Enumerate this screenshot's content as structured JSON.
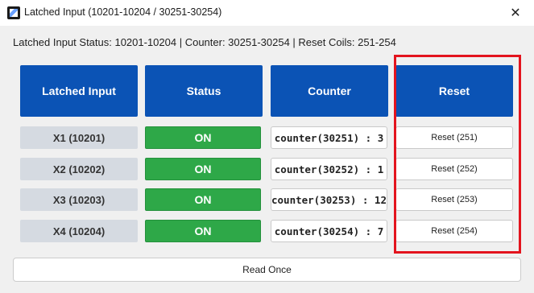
{
  "window": {
    "title": "Latched Input (10201-10204 / 30251-30254)",
    "app_icon": "app-icon",
    "close_symbol": "✕"
  },
  "status_line": "Latched Input Status: 10201-10204 | Counter: 30251-30254 | Reset Coils: 251-254",
  "headers": {
    "latched_input": "Latched Input",
    "status": "Status",
    "counter": "Counter",
    "reset": "Reset"
  },
  "rows": [
    {
      "label": "X1 (10201)",
      "status": "ON",
      "counter": "counter(30251) : 3",
      "reset": "Reset (251)"
    },
    {
      "label": "X2 (10202)",
      "status": "ON",
      "counter": "counter(30252) : 1",
      "reset": "Reset (252)"
    },
    {
      "label": "X3 (10203)",
      "status": "ON",
      "counter": "counter(30253) : 12",
      "reset": "Reset (253)"
    },
    {
      "label": "X4 (10204)",
      "status": "ON",
      "counter": "counter(30254) : 7",
      "reset": "Reset (254)"
    }
  ],
  "read_once_label": "Read Once",
  "colors": {
    "header_blue": "#0b53b5",
    "status_on_green": "#2ea848",
    "label_gray": "#d5dae1",
    "highlight_red": "#e3141e"
  }
}
